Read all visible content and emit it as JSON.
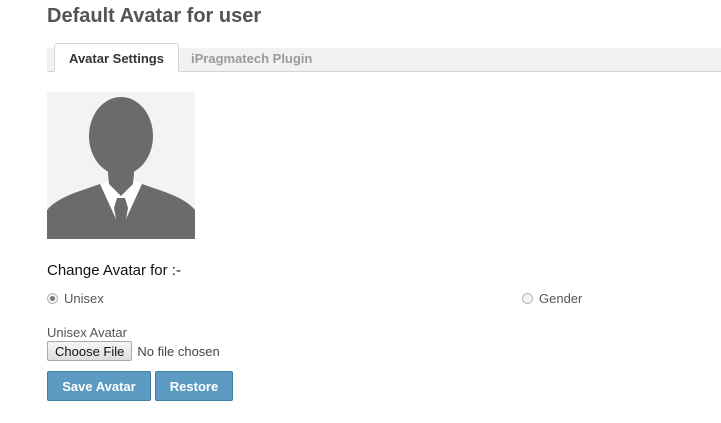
{
  "page": {
    "title": "Default Avatar for user"
  },
  "tabs": [
    {
      "label": "Avatar Settings",
      "active": true
    },
    {
      "label": "iPragmatech Plugin",
      "active": false
    }
  ],
  "avatar": {
    "icon": "default-user-silhouette-icon",
    "color": "#6b6b6d"
  },
  "form": {
    "heading": "Change Avatar for :-",
    "options": [
      {
        "label": "Unisex",
        "checked": true
      },
      {
        "label": "Gender",
        "checked": false
      }
    ],
    "file_label": "Unisex Avatar",
    "choose_file_label": "Choose File",
    "file_status": "No file chosen"
  },
  "actions": {
    "save_label": "Save Avatar",
    "restore_label": "Restore",
    "button_color": "#5b9bc1"
  }
}
